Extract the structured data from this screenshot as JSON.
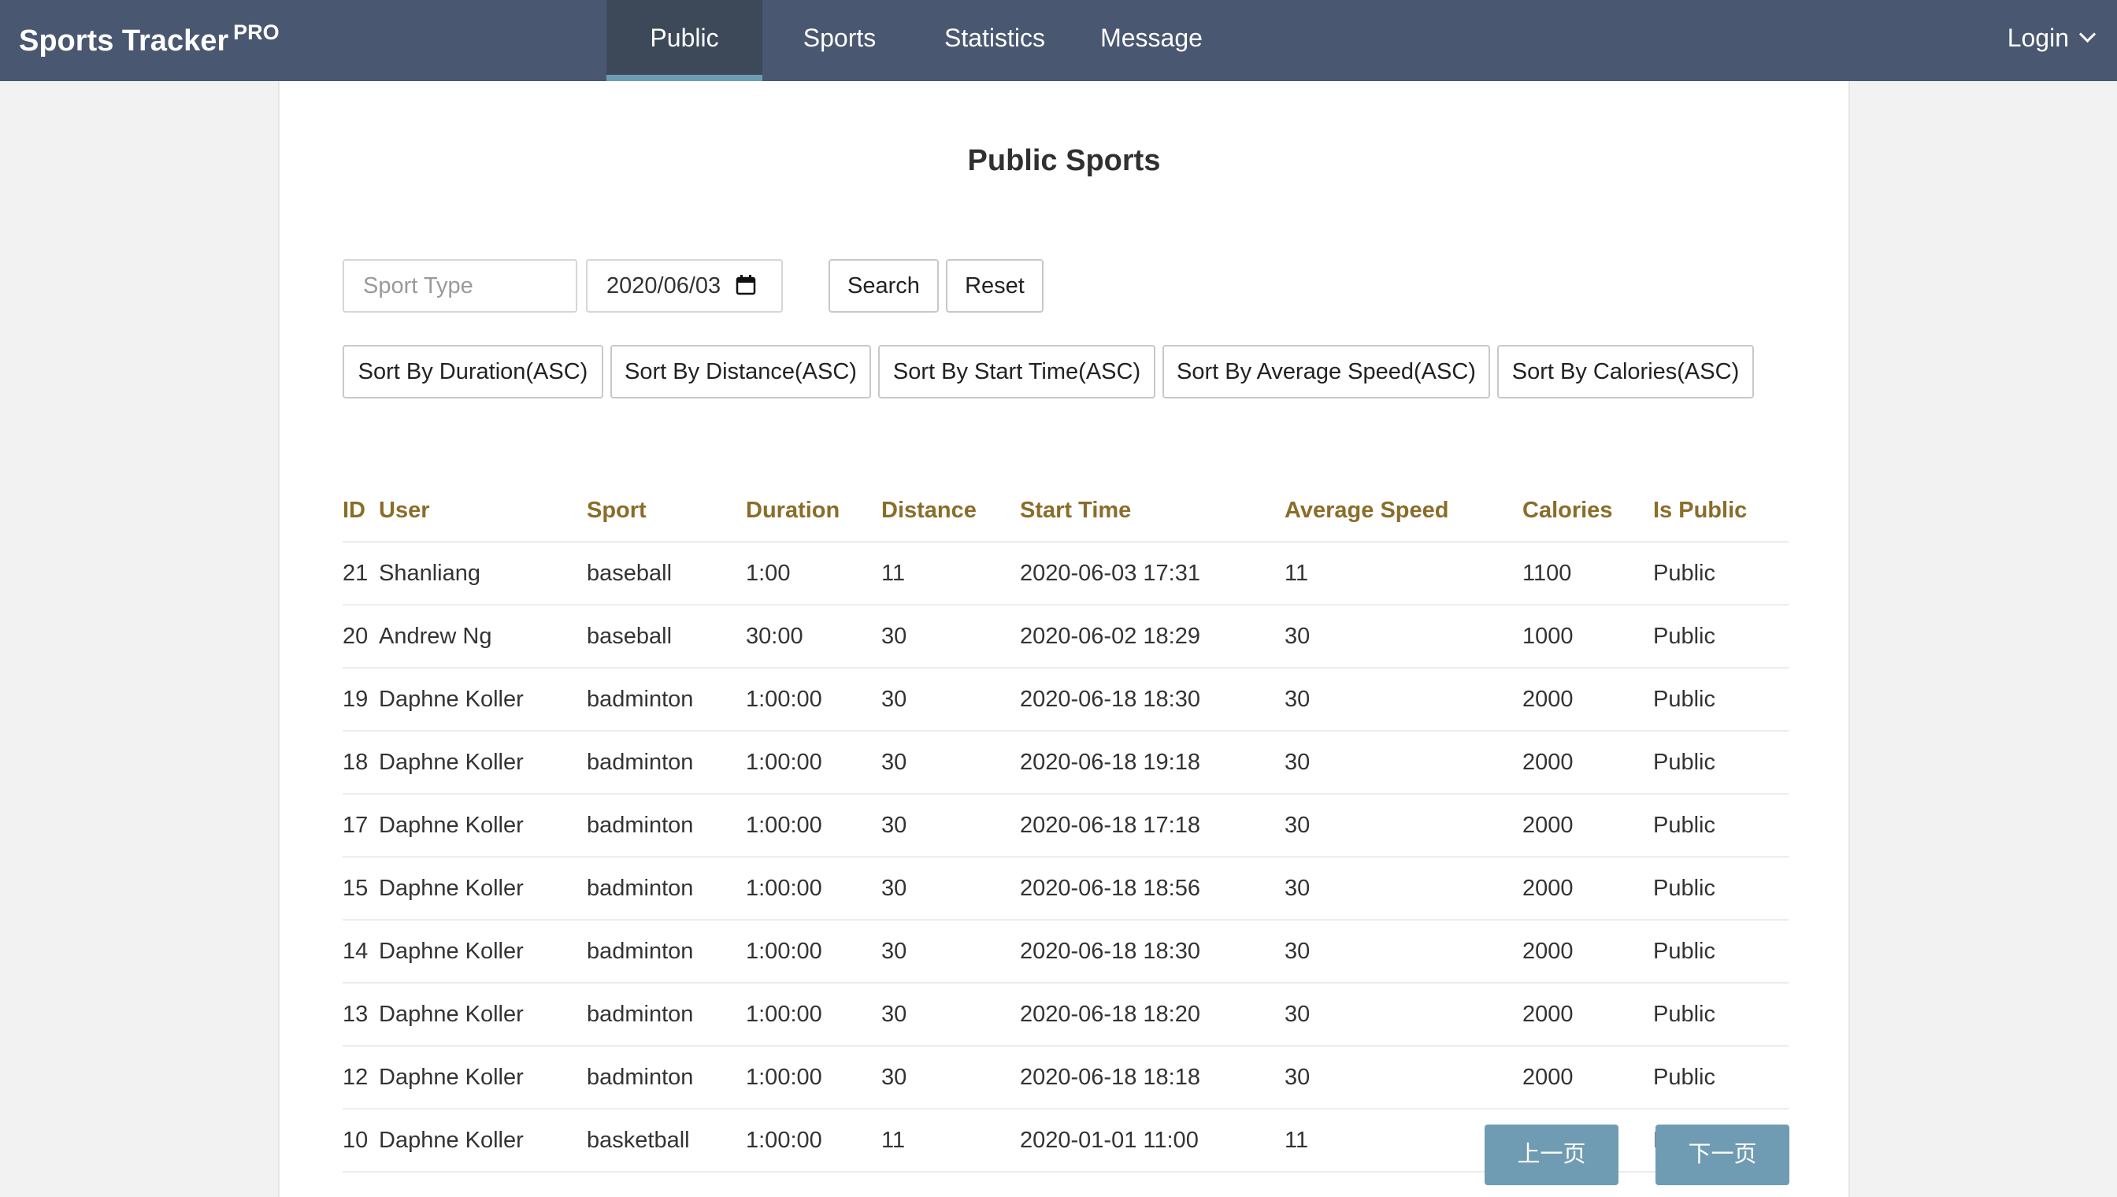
{
  "nav": {
    "brand": "Sports Tracker",
    "brand_badge": "PRO",
    "items": [
      {
        "label": "Public"
      },
      {
        "label": "Sports"
      },
      {
        "label": "Statistics"
      },
      {
        "label": "Message"
      }
    ],
    "active_item": "Public",
    "login_label": "Login"
  },
  "page": {
    "title": "Public Sports"
  },
  "filters": {
    "sport_type_placeholder": "Sport Type",
    "sport_type_value": "",
    "date_value": "2020/06/03",
    "search_label": "Search",
    "reset_label": "Reset"
  },
  "sort_buttons": [
    {
      "label": "Sort By Duration(ASC)"
    },
    {
      "label": "Sort By Distance(ASC)"
    },
    {
      "label": "Sort By Start Time(ASC)"
    },
    {
      "label": "Sort By Average Speed(ASC)"
    },
    {
      "label": "Sort By Calories(ASC)"
    }
  ],
  "table": {
    "headers": [
      "ID",
      "User",
      "Sport",
      "Duration",
      "Distance",
      "Start Time",
      "Average Speed",
      "Calories",
      "Is Public"
    ],
    "rows": [
      [
        "21",
        "Shanliang",
        "baseball",
        "1:00",
        "11",
        "2020-06-03 17:31",
        "11",
        "1100",
        "Public"
      ],
      [
        "20",
        "Andrew Ng",
        "baseball",
        "30:00",
        "30",
        "2020-06-02 18:29",
        "30",
        "1000",
        "Public"
      ],
      [
        "19",
        "Daphne Koller",
        "badminton",
        "1:00:00",
        "30",
        "2020-06-18 18:30",
        "30",
        "2000",
        "Public"
      ],
      [
        "18",
        "Daphne Koller",
        "badminton",
        "1:00:00",
        "30",
        "2020-06-18 19:18",
        "30",
        "2000",
        "Public"
      ],
      [
        "17",
        "Daphne Koller",
        "badminton",
        "1:00:00",
        "30",
        "2020-06-18 17:18",
        "30",
        "2000",
        "Public"
      ],
      [
        "15",
        "Daphne Koller",
        "badminton",
        "1:00:00",
        "30",
        "2020-06-18 18:56",
        "30",
        "2000",
        "Public"
      ],
      [
        "14",
        "Daphne Koller",
        "badminton",
        "1:00:00",
        "30",
        "2020-06-18 18:30",
        "30",
        "2000",
        "Public"
      ],
      [
        "13",
        "Daphne Koller",
        "badminton",
        "1:00:00",
        "30",
        "2020-06-18 18:20",
        "30",
        "2000",
        "Public"
      ],
      [
        "12",
        "Daphne Koller",
        "badminton",
        "1:00:00",
        "30",
        "2020-06-18 18:18",
        "30",
        "2000",
        "Public"
      ],
      [
        "10",
        "Daphne Koller",
        "basketball",
        "1:00:00",
        "11",
        "2020-01-01 11:00",
        "11",
        "1100",
        "Public"
      ]
    ]
  },
  "pager": {
    "prev_label": "上一页",
    "next_label": "下一页"
  },
  "colors": {
    "nav_bg": "#495770",
    "nav_active_bg": "#3d4959",
    "nav_active_underline": "#6e9db3",
    "header_text": "#8a6d2a",
    "pager_button": "#6f9cb3"
  },
  "icons": {
    "date_field": "calendar-icon",
    "login_menu": "chevron-down-icon"
  }
}
